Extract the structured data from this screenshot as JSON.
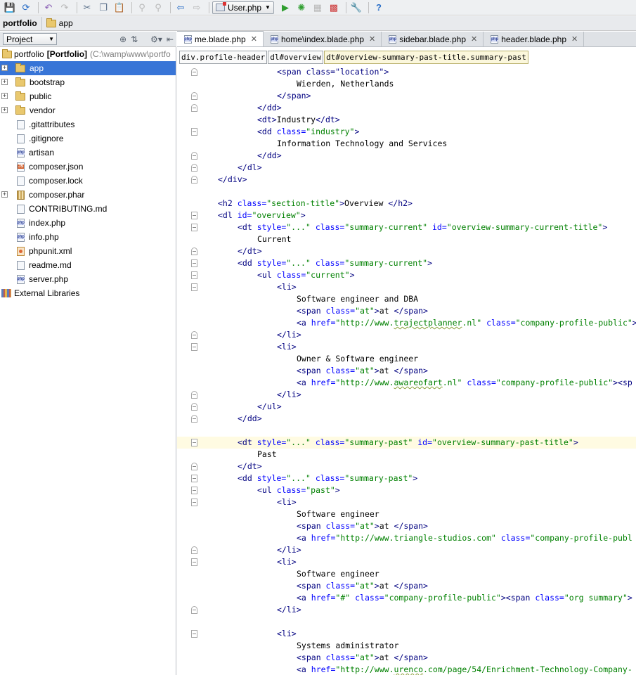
{
  "toolbar": {
    "run_config_label": "User.php"
  },
  "breadcrumb": {
    "project": "portfolio",
    "folder": "app"
  },
  "project_panel": {
    "view_label": "Project",
    "root": {
      "name": "portfolio",
      "module": "[Portfolio]",
      "path": "(C:\\wamp\\www\\portfo"
    },
    "items": [
      {
        "label": "app",
        "type": "folder",
        "expandable": true,
        "selected": true
      },
      {
        "label": "bootstrap",
        "type": "folder",
        "expandable": true
      },
      {
        "label": "public",
        "type": "folder",
        "expandable": true
      },
      {
        "label": "vendor",
        "type": "folder",
        "expandable": true
      },
      {
        "label": ".gitattributes",
        "type": "file"
      },
      {
        "label": ".gitignore",
        "type": "file"
      },
      {
        "label": "artisan",
        "type": "php"
      },
      {
        "label": "composer.json",
        "type": "js"
      },
      {
        "label": "composer.lock",
        "type": "file"
      },
      {
        "label": "composer.phar",
        "type": "phar",
        "expandable": true
      },
      {
        "label": "CONTRIBUTING.md",
        "type": "file"
      },
      {
        "label": "index.php",
        "type": "php"
      },
      {
        "label": "info.php",
        "type": "php"
      },
      {
        "label": "phpunit.xml",
        "type": "xml"
      },
      {
        "label": "readme.md",
        "type": "file"
      },
      {
        "label": "server.php",
        "type": "php"
      }
    ],
    "external_libraries": "External Libraries"
  },
  "tabs": [
    {
      "label": "me.blade.php",
      "active": true
    },
    {
      "label": "home\\index.blade.php"
    },
    {
      "label": "sidebar.blade.php"
    },
    {
      "label": "header.blade.php"
    }
  ],
  "tag_path": [
    "div.profile-header",
    "dl#overview",
    "dt#overview-summary-past-title.summary-past"
  ],
  "code_lines": [
    {
      "i": 3,
      "p": [
        [
          "t",
          "<span class=\"location\">"
        ]
      ],
      "fold": "end"
    },
    {
      "i": 4,
      "p": [
        [
          "x",
          "Wierden, Netherlands"
        ]
      ]
    },
    {
      "i": 3,
      "p": [
        [
          "t",
          "</span>"
        ]
      ],
      "fold": "end"
    },
    {
      "i": 2,
      "p": [
        [
          "t",
          "</dd>"
        ]
      ],
      "fold": "end"
    },
    {
      "i": 2,
      "p": [
        [
          "t",
          "<dt>"
        ],
        [
          "x",
          "Industry"
        ],
        [
          "t",
          "</dt>"
        ]
      ]
    },
    {
      "i": 2,
      "p": [
        [
          "t",
          "<dd "
        ],
        [
          "a",
          "class="
        ],
        [
          "s",
          "\"industry\""
        ],
        [
          "t",
          ">"
        ]
      ],
      "fold": "start"
    },
    {
      "i": 3,
      "p": [
        [
          "x",
          "Information Technology and Services"
        ]
      ]
    },
    {
      "i": 2,
      "p": [
        [
          "t",
          "</dd>"
        ]
      ],
      "fold": "end"
    },
    {
      "i": 1,
      "p": [
        [
          "t",
          "</dl>"
        ]
      ],
      "fold": "end"
    },
    {
      "i": 0,
      "p": [
        [
          "t",
          "</div>"
        ]
      ],
      "fold": "end"
    },
    {
      "i": 0,
      "p": []
    },
    {
      "i": 0,
      "p": [
        [
          "t",
          "<h2 "
        ],
        [
          "a",
          "class="
        ],
        [
          "s",
          "\"section-title\""
        ],
        [
          "t",
          ">"
        ],
        [
          "x",
          "Overview "
        ],
        [
          "t",
          "</h2>"
        ]
      ]
    },
    {
      "i": 0,
      "p": [
        [
          "t",
          "<dl "
        ],
        [
          "a",
          "id="
        ],
        [
          "s",
          "\"overview\""
        ],
        [
          "t",
          ">"
        ]
      ],
      "fold": "start"
    },
    {
      "i": 1,
      "p": [
        [
          "t",
          "<dt "
        ],
        [
          "a",
          "style="
        ],
        [
          "s",
          "\"...\""
        ],
        [
          "t",
          " "
        ],
        [
          "a",
          "class="
        ],
        [
          "s",
          "\"summary-current\""
        ],
        [
          "t",
          " "
        ],
        [
          "a",
          "id="
        ],
        [
          "s",
          "\"overview-summary-current-title\""
        ],
        [
          "t",
          ">"
        ]
      ],
      "fold": "start"
    },
    {
      "i": 2,
      "p": [
        [
          "x",
          "Current"
        ]
      ]
    },
    {
      "i": 1,
      "p": [
        [
          "t",
          "</dt>"
        ]
      ],
      "fold": "end"
    },
    {
      "i": 1,
      "p": [
        [
          "t",
          "<dd "
        ],
        [
          "a",
          "style="
        ],
        [
          "s",
          "\"...\""
        ],
        [
          "t",
          " "
        ],
        [
          "a",
          "class="
        ],
        [
          "s",
          "\"summary-current\""
        ],
        [
          "t",
          ">"
        ]
      ],
      "fold": "start"
    },
    {
      "i": 2,
      "p": [
        [
          "t",
          "<ul "
        ],
        [
          "a",
          "class="
        ],
        [
          "s",
          "\"current\""
        ],
        [
          "t",
          ">"
        ]
      ],
      "fold": "start"
    },
    {
      "i": 3,
      "p": [
        [
          "t",
          "<li>"
        ]
      ],
      "fold": "start"
    },
    {
      "i": 4,
      "p": [
        [
          "x",
          "Software engineer and DBA"
        ]
      ]
    },
    {
      "i": 4,
      "p": [
        [
          "t",
          "<span "
        ],
        [
          "a",
          "class="
        ],
        [
          "s",
          "\"at\""
        ],
        [
          "t",
          ">"
        ],
        [
          "x",
          "at "
        ],
        [
          "t",
          "</span>"
        ]
      ]
    },
    {
      "i": 4,
      "p": [
        [
          "t",
          "<a "
        ],
        [
          "a",
          "href="
        ],
        [
          "s",
          "\"http://www."
        ],
        [
          "su",
          "trajectplanner"
        ],
        [
          "s",
          ".nl\""
        ],
        [
          "t",
          " "
        ],
        [
          "a",
          "class="
        ],
        [
          "s",
          "\"company-profile-public\""
        ],
        [
          "t",
          ">"
        ]
      ]
    },
    {
      "i": 3,
      "p": [
        [
          "t",
          "</li>"
        ]
      ],
      "fold": "end"
    },
    {
      "i": 3,
      "p": [
        [
          "t",
          "<li>"
        ]
      ],
      "fold": "start"
    },
    {
      "i": 4,
      "p": [
        [
          "x",
          "Owner & Software engineer"
        ]
      ]
    },
    {
      "i": 4,
      "p": [
        [
          "t",
          "<span "
        ],
        [
          "a",
          "class="
        ],
        [
          "s",
          "\"at\""
        ],
        [
          "t",
          ">"
        ],
        [
          "x",
          "at "
        ],
        [
          "t",
          "</span>"
        ]
      ]
    },
    {
      "i": 4,
      "p": [
        [
          "t",
          "<a "
        ],
        [
          "a",
          "href="
        ],
        [
          "s",
          "\"http://www."
        ],
        [
          "su",
          "awareofart"
        ],
        [
          "s",
          ".nl\""
        ],
        [
          "t",
          " "
        ],
        [
          "a",
          "class="
        ],
        [
          "s",
          "\"company-profile-public\""
        ],
        [
          "t",
          "><sp"
        ]
      ]
    },
    {
      "i": 3,
      "p": [
        [
          "t",
          "</li>"
        ]
      ],
      "fold": "end"
    },
    {
      "i": 2,
      "p": [
        [
          "t",
          "</ul>"
        ]
      ],
      "fold": "end"
    },
    {
      "i": 1,
      "p": [
        [
          "t",
          "</dd>"
        ]
      ],
      "fold": "end"
    },
    {
      "i": 0,
      "p": []
    },
    {
      "i": 1,
      "p": [
        [
          "t",
          "<dt "
        ],
        [
          "a",
          "style="
        ],
        [
          "s",
          "\"...\""
        ],
        [
          "t",
          " "
        ],
        [
          "a",
          "class="
        ],
        [
          "s",
          "\"summary-past\""
        ],
        [
          "t",
          " "
        ],
        [
          "a",
          "id="
        ],
        [
          "s",
          "\"overview-summary-past-title\""
        ],
        [
          "t",
          ">"
        ]
      ],
      "fold": "start",
      "cur": true
    },
    {
      "i": 2,
      "p": [
        [
          "x",
          "Past"
        ]
      ]
    },
    {
      "i": 1,
      "p": [
        [
          "t",
          "</dt>"
        ]
      ],
      "fold": "end"
    },
    {
      "i": 1,
      "p": [
        [
          "t",
          "<dd "
        ],
        [
          "a",
          "style="
        ],
        [
          "s",
          "\"...\""
        ],
        [
          "t",
          " "
        ],
        [
          "a",
          "class="
        ],
        [
          "s",
          "\"summary-past\""
        ],
        [
          "t",
          ">"
        ]
      ],
      "fold": "start"
    },
    {
      "i": 2,
      "p": [
        [
          "t",
          "<ul "
        ],
        [
          "a",
          "class="
        ],
        [
          "s",
          "\"past\""
        ],
        [
          "t",
          ">"
        ]
      ],
      "fold": "start"
    },
    {
      "i": 3,
      "p": [
        [
          "t",
          "<li>"
        ]
      ],
      "fold": "start"
    },
    {
      "i": 4,
      "p": [
        [
          "x",
          "Software engineer"
        ]
      ]
    },
    {
      "i": 4,
      "p": [
        [
          "t",
          "<span "
        ],
        [
          "a",
          "class="
        ],
        [
          "s",
          "\"at\""
        ],
        [
          "t",
          ">"
        ],
        [
          "x",
          "at "
        ],
        [
          "t",
          "</span>"
        ]
      ]
    },
    {
      "i": 4,
      "p": [
        [
          "t",
          "<a "
        ],
        [
          "a",
          "href="
        ],
        [
          "s",
          "\"http://www.triangle-studios.com\""
        ],
        [
          "t",
          " "
        ],
        [
          "a",
          "class="
        ],
        [
          "s",
          "\"company-profile-publ"
        ]
      ]
    },
    {
      "i": 3,
      "p": [
        [
          "t",
          "</li>"
        ]
      ],
      "fold": "end"
    },
    {
      "i": 3,
      "p": [
        [
          "t",
          "<li>"
        ]
      ],
      "fold": "start"
    },
    {
      "i": 4,
      "p": [
        [
          "x",
          "Software engineer"
        ]
      ]
    },
    {
      "i": 4,
      "p": [
        [
          "t",
          "<span "
        ],
        [
          "a",
          "class="
        ],
        [
          "s",
          "\"at\""
        ],
        [
          "t",
          ">"
        ],
        [
          "x",
          "at "
        ],
        [
          "t",
          "</span>"
        ]
      ]
    },
    {
      "i": 4,
      "p": [
        [
          "t",
          "<a "
        ],
        [
          "a",
          "href="
        ],
        [
          "s",
          "\"#\""
        ],
        [
          "t",
          " "
        ],
        [
          "a",
          "class="
        ],
        [
          "s",
          "\"company-profile-public\""
        ],
        [
          "t",
          "><span "
        ],
        [
          "a",
          "class="
        ],
        [
          "s",
          "\"org summary\""
        ],
        [
          "t",
          ">"
        ]
      ]
    },
    {
      "i": 3,
      "p": [
        [
          "t",
          "</li>"
        ]
      ],
      "fold": "end"
    },
    {
      "i": 0,
      "p": []
    },
    {
      "i": 3,
      "p": [
        [
          "t",
          "<li>"
        ]
      ],
      "fold": "start"
    },
    {
      "i": 4,
      "p": [
        [
          "x",
          "Systems administrator"
        ]
      ]
    },
    {
      "i": 4,
      "p": [
        [
          "t",
          "<span "
        ],
        [
          "a",
          "class="
        ],
        [
          "s",
          "\"at\""
        ],
        [
          "t",
          ">"
        ],
        [
          "x",
          "at "
        ],
        [
          "t",
          "</span>"
        ]
      ]
    },
    {
      "i": 4,
      "p": [
        [
          "t",
          "<a "
        ],
        [
          "a",
          "href="
        ],
        [
          "s",
          "\"http://www."
        ],
        [
          "su",
          "urenco"
        ],
        [
          "s",
          ".com/page/54/Enrichment-Technology-Company-"
        ]
      ]
    },
    {
      "i": 3,
      "p": [
        [
          "t",
          "</li>"
        ]
      ],
      "fold": "end"
    }
  ]
}
